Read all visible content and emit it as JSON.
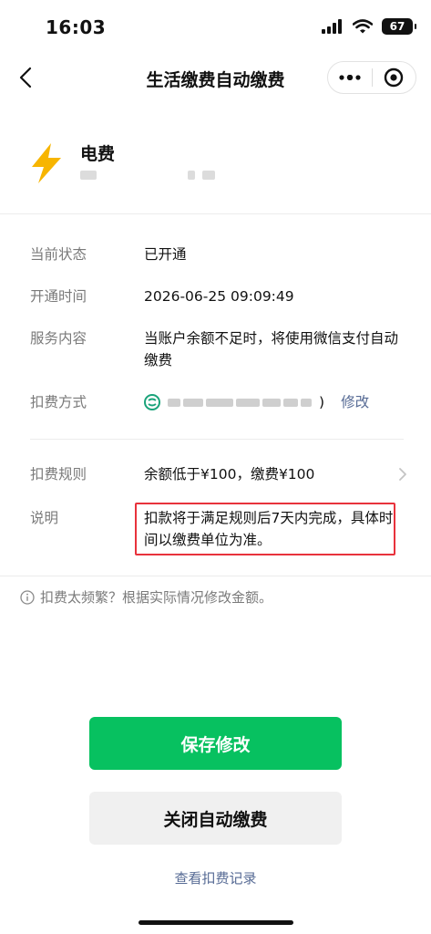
{
  "status_bar": {
    "time": "16:03",
    "battery": "67"
  },
  "nav": {
    "title": "生活缴费自动缴费"
  },
  "service": {
    "name": "电费",
    "icon": "lightning-icon",
    "accent": "#f7b500"
  },
  "rows": {
    "status": {
      "label": "当前状态",
      "value": "已开通"
    },
    "open_time": {
      "label": "开通时间",
      "value": "2026-06-25 09:09:49"
    },
    "service_content": {
      "label": "服务内容",
      "value": "当账户余额不足时，将使用微信支付自动缴费"
    },
    "pay_method": {
      "label": "扣费方式",
      "value_suffix": ")",
      "edit": "修改"
    },
    "rule": {
      "label": "扣费规则",
      "value": "余额低于¥100，缴费¥100"
    },
    "note": {
      "label": "说明",
      "value": "扣款将于满足规则后7天内完成，具体时间以缴费单位为准。"
    }
  },
  "tip": "扣费太频繁？根据实际情况修改金额。",
  "buttons": {
    "save": "保存修改",
    "close": "关闭自动缴费"
  },
  "record_link": "查看扣费记录",
  "colors": {
    "primary": "#07c160",
    "link": "#576b95",
    "highlight": "#e8323c"
  }
}
